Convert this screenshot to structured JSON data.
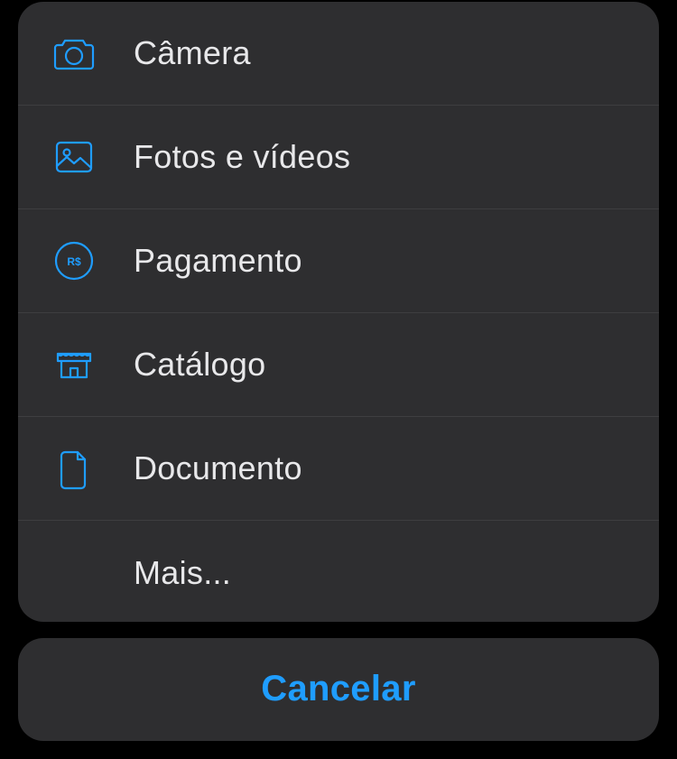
{
  "accent_color": "#1f9dff",
  "text_color": "#e8e8ea",
  "menu": {
    "items": [
      {
        "id": "camera",
        "label": "Câmera",
        "icon": "camera-icon"
      },
      {
        "id": "photos",
        "label": "Fotos e vídeos",
        "icon": "photos-icon"
      },
      {
        "id": "payment",
        "label": "Pagamento",
        "icon": "payment-brl-icon"
      },
      {
        "id": "catalog",
        "label": "Catálogo",
        "icon": "catalog-icon"
      },
      {
        "id": "document",
        "label": "Documento",
        "icon": "document-icon"
      },
      {
        "id": "more",
        "label": "Mais...",
        "icon": null
      }
    ]
  },
  "cancel_label": "Cancelar"
}
